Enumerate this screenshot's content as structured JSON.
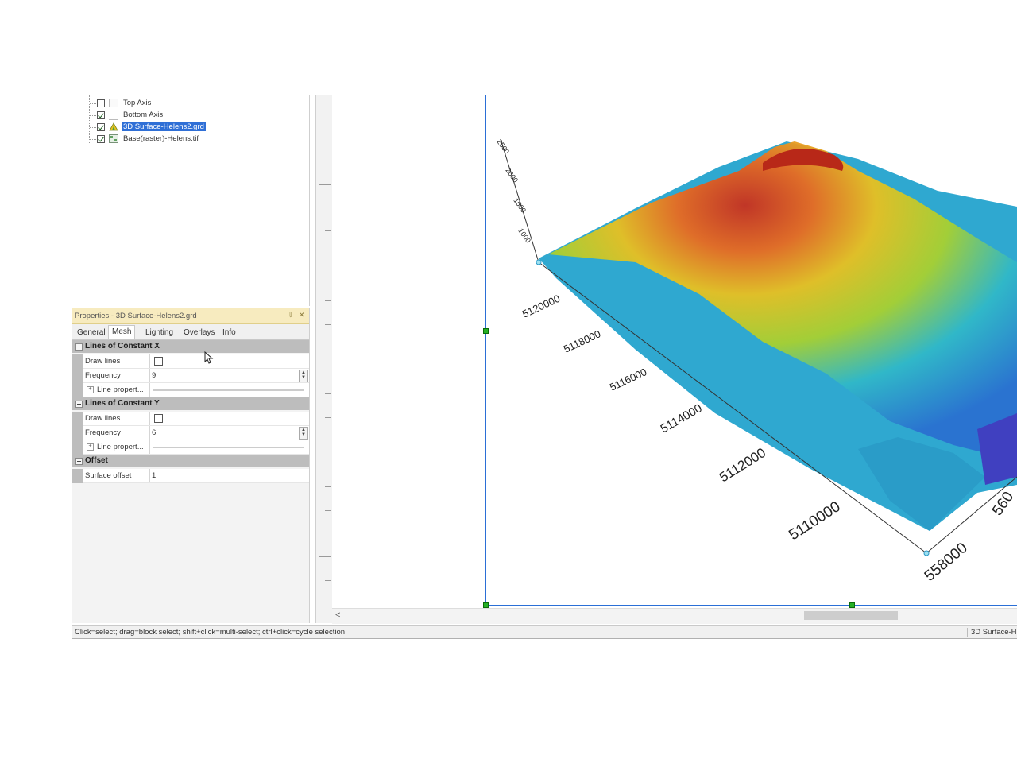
{
  "object_tree": {
    "items": [
      {
        "label": "Top Axis",
        "checked": false
      },
      {
        "label": "Bottom Axis",
        "checked": true
      },
      {
        "label": "3D Surface-Helens2.grd",
        "checked": true,
        "selected": true
      },
      {
        "label": "Base(raster)-Helens.tif",
        "checked": true
      }
    ]
  },
  "properties": {
    "title": "Properties - 3D Surface-Helens2.grd",
    "pin_icon": "⇩",
    "close_icon": "✕",
    "tabs": [
      "General",
      "Mesh",
      "Lighting",
      "Overlays",
      "Info"
    ],
    "active_tab": "Mesh",
    "sections": {
      "const_x": {
        "header": "Lines of Constant X",
        "draw_lines_label": "Draw lines",
        "draw_lines_checked": false,
        "frequency_label": "Frequency",
        "frequency_value": "9",
        "line_props_label": "Line propert..."
      },
      "const_y": {
        "header": "Lines of Constant Y",
        "draw_lines_label": "Draw lines",
        "draw_lines_checked": false,
        "frequency_label": "Frequency",
        "frequency_value": "6",
        "line_props_label": "Line propert..."
      },
      "offset": {
        "header": "Offset",
        "surface_offset_label": "Surface offset",
        "surface_offset_value": "1"
      }
    }
  },
  "plot": {
    "z_ticks": [
      "2500",
      "2000",
      "1500",
      "1000"
    ],
    "y_ticks": [
      "5120000",
      "5118000",
      "5116000",
      "5114000",
      "5112000",
      "5110000"
    ],
    "x_ticks": [
      "558000",
      "560"
    ],
    "colors": {
      "low": "#3060d0",
      "mid_low": "#20c0d0",
      "mid": "#c8d820",
      "high": "#f0a020",
      "peak": "#d03020"
    }
  },
  "scrollbar": {
    "left_arrow": "<"
  },
  "status": {
    "hint": "Click=select; drag=block select; shift+click=multi-select; ctrl+click=cycle selection",
    "right": "3D Surface-H"
  }
}
